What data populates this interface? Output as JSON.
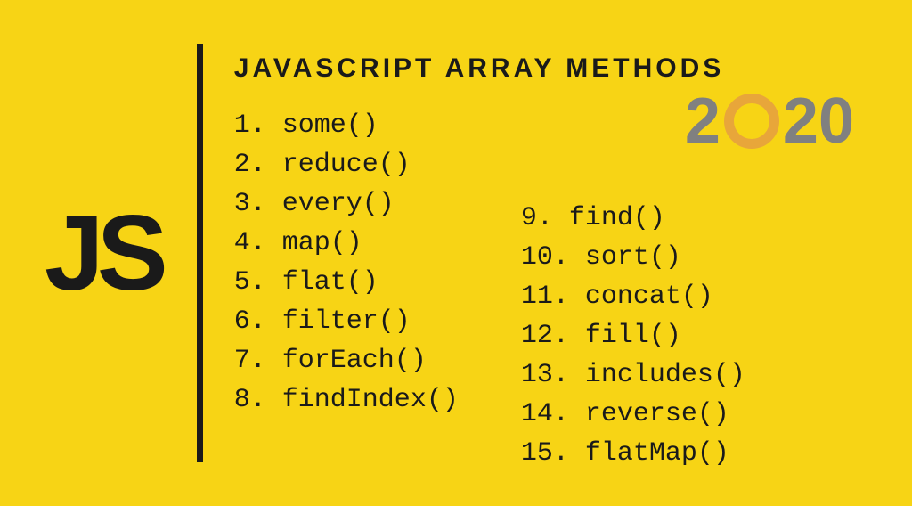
{
  "logo": "JS",
  "title": "JAVASCRIPT ARRAY METHODS",
  "year": {
    "d1": "2",
    "d2": "2",
    "d3": "0"
  },
  "methods_left": [
    "1. some()",
    "2. reduce()",
    "3. every()",
    "4. map()",
    "5. flat()",
    "6. filter()",
    "7. forEach()",
    "8. findIndex()"
  ],
  "methods_right": [
    "9. find()",
    "10. sort()",
    "11. concat()",
    "12. fill()",
    "13. includes()",
    "14. reverse()",
    "15. flatMap()"
  ]
}
